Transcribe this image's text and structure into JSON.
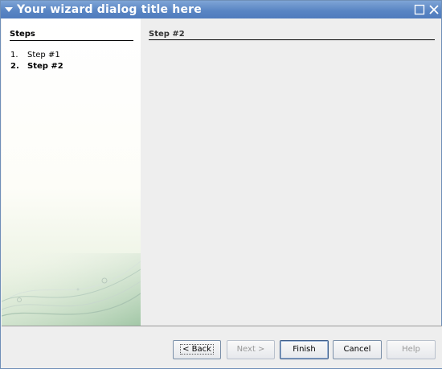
{
  "window": {
    "title": "Your wizard dialog title here"
  },
  "steps_panel": {
    "header": "Steps",
    "items": [
      {
        "number": "1.",
        "label": "Step #1",
        "current": false
      },
      {
        "number": "2.",
        "label": "Step #2",
        "current": true
      }
    ]
  },
  "content": {
    "title": "Step #2"
  },
  "buttons": {
    "back": "< Back",
    "next": "Next >",
    "finish": "Finish",
    "cancel": "Cancel",
    "help": "Help"
  },
  "colors": {
    "titlebar": "#5a86c4",
    "panel_background": "#eeeeee",
    "decoration_green": "#6aa57a"
  }
}
